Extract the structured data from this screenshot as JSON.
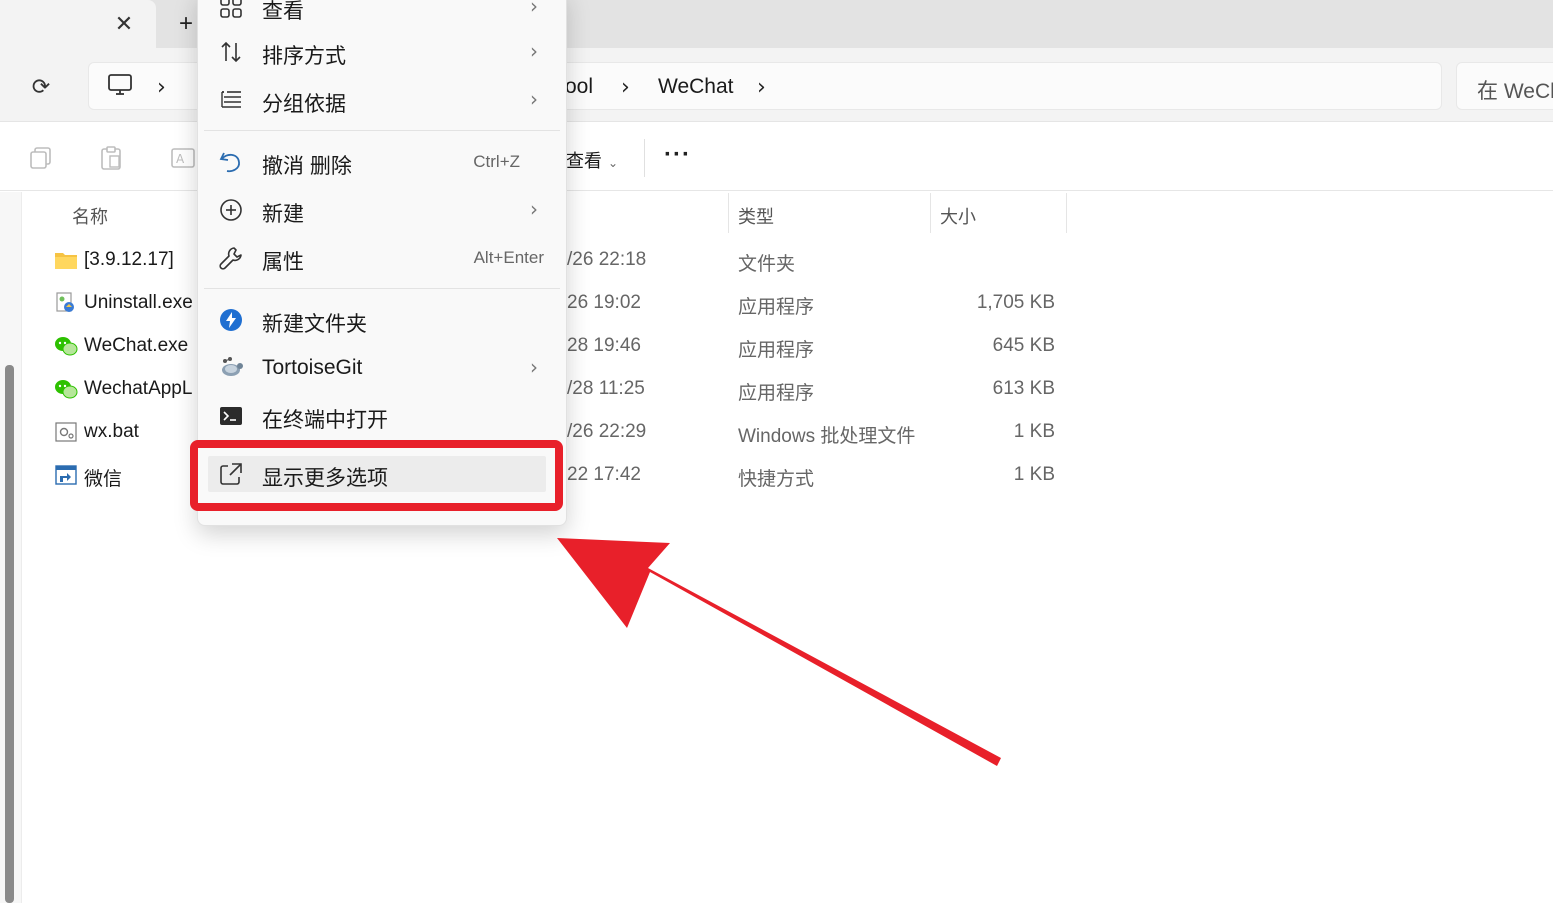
{
  "tabstrip": {
    "close_label": "✕",
    "add_label": "+"
  },
  "navbar": {
    "refresh_glyph": "⟳",
    "address": {
      "device_icon": "computer-icon",
      "segments": [
        "ool",
        "WeChat"
      ],
      "chevron": "›"
    },
    "search_placeholder": "在 WeCh"
  },
  "commandbar": {
    "icons": [
      "copy-icon",
      "paste-icon",
      "rename-icon"
    ],
    "view_label": "查看",
    "view_chevron": "⌄",
    "more_label": "···"
  },
  "filelist": {
    "columns": {
      "name": "名称",
      "type": "类型",
      "size": "大小"
    },
    "rows": [
      {
        "name": "[3.9.12.17]",
        "date": "/26 22:18",
        "type": "文件夹",
        "size": "",
        "icon": "folder-icon"
      },
      {
        "name": "Uninstall.exe",
        "date": "26 19:02",
        "type": "应用程序",
        "size": "1,705 KB",
        "icon": "uninstaller-icon"
      },
      {
        "name": "WeChat.exe",
        "date": "28 19:46",
        "type": "应用程序",
        "size": "645 KB",
        "icon": "wechat-icon"
      },
      {
        "name": "WechatAppL",
        "date": "/28 11:25",
        "type": "应用程序",
        "size": "613 KB",
        "icon": "wechat-icon"
      },
      {
        "name": "wx.bat",
        "date": "/26 22:29",
        "type": "Windows 批处理文件",
        "size": "1 KB",
        "icon": "batch-file-icon"
      },
      {
        "name": "微信",
        "date": "22 17:42",
        "type": "快捷方式",
        "size": "1 KB",
        "icon": "shortcut-icon"
      }
    ]
  },
  "context_menu": {
    "submenu_glyph": "›",
    "items": [
      {
        "label": "查看",
        "icon": "grid-view-icon",
        "submenu": true,
        "accel": ""
      },
      {
        "label": "排序方式",
        "icon": "sort-icon",
        "submenu": true,
        "accel": ""
      },
      {
        "label": "分组依据",
        "icon": "group-by-icon",
        "submenu": true,
        "accel": ""
      },
      {
        "label": "撤消 删除",
        "icon": "undo-icon",
        "submenu": false,
        "accel": "Ctrl+Z"
      },
      {
        "label": "新建",
        "icon": "new-plus-icon",
        "submenu": true,
        "accel": ""
      },
      {
        "label": "属性",
        "icon": "wrench-icon",
        "submenu": false,
        "accel": "Alt+Enter"
      },
      {
        "label": "新建文件夹",
        "icon": "new-folder-app-icon",
        "submenu": false,
        "accel": ""
      },
      {
        "label": "TortoiseGit",
        "icon": "tortoisegit-icon",
        "submenu": true,
        "accel": ""
      },
      {
        "label": "在终端中打开",
        "icon": "terminal-icon",
        "submenu": false,
        "accel": ""
      },
      {
        "label": "显示更多选项",
        "icon": "show-more-icon",
        "submenu": false,
        "accel": ""
      }
    ]
  },
  "annotation": {
    "color": "#e8202a"
  }
}
